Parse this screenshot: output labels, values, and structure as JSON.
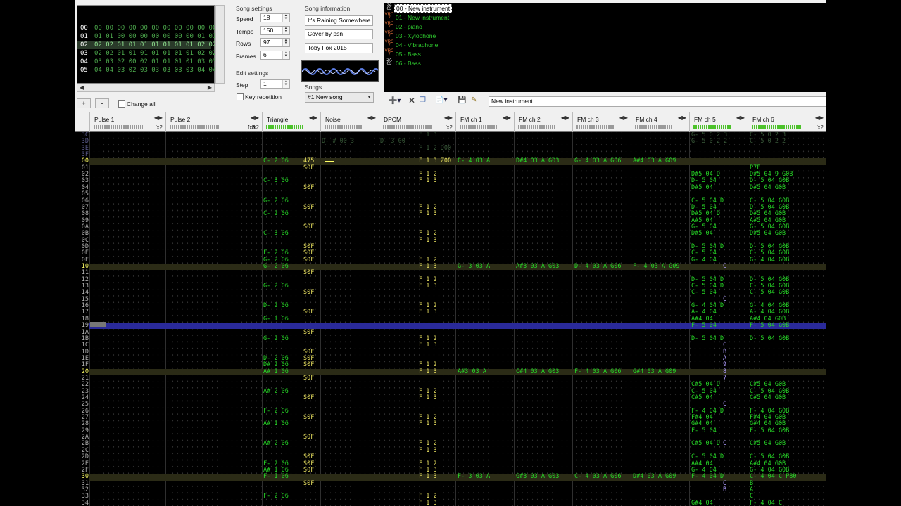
{
  "frames": {
    "rows": [
      {
        "n": "00",
        "v": "00 00 00 00 00 00 00 00 00 00 00"
      },
      {
        "n": "01",
        "v": "01 01 00 00 00 00 00 00 00 01 01"
      },
      {
        "n": "02",
        "v": "02 02 01 01 01 01 01 01 01 02 02",
        "sel": true
      },
      {
        "n": "03",
        "v": "02 02 01 01 01 01 01 01 01 02 02"
      },
      {
        "n": "04",
        "v": "03 03 02 00 02 01 01 01 01 03 03"
      },
      {
        "n": "05",
        "v": "04 04 03 02 03 03 03 03 03 04 04"
      }
    ],
    "add_label": "+",
    "remove_label": "-",
    "change_all_label": "Change all"
  },
  "song_settings": {
    "title": "Song settings",
    "speed_label": "Speed",
    "speed": "18",
    "tempo_label": "Tempo",
    "tempo": "150",
    "rows_label": "Rows",
    "rows": "97",
    "frames_label": "Frames",
    "frames": "6"
  },
  "edit_settings": {
    "title": "Edit settings",
    "step_label": "Step",
    "step": "1",
    "key_repetition_label": "Key repetition"
  },
  "song_info": {
    "title": "Song information",
    "name": "It's Raining Somewhere Else",
    "artist": "Cover by psn",
    "copyright": "Toby Fox 2015"
  },
  "songs": {
    "label": "Songs",
    "selected": "#1 New song"
  },
  "instruments": [
    {
      "icon": "2A\n03",
      "name": "00 - New instrument",
      "sel": true,
      "n": true
    },
    {
      "icon": "VRC\n7",
      "name": "01 - New instrument"
    },
    {
      "icon": "VRC\n7",
      "name": "02 - piano"
    },
    {
      "icon": "VRC\n7",
      "name": "03 - Xylophone"
    },
    {
      "icon": "VRC\n7",
      "name": "04 - Vibraphone"
    },
    {
      "icon": "VRC\n7",
      "name": "05 - Bass"
    },
    {
      "icon": "2A\n03",
      "name": "06 - Bass",
      "n": true
    }
  ],
  "instrument_name": "New instrument",
  "channels": [
    {
      "name": "Pulse 1",
      "fx": "fx2"
    },
    {
      "name": "Pulse 2",
      "fx": "fx2"
    },
    {
      "name": "",
      "fx": "fx3"
    },
    {
      "name": "Triangle",
      "fx": ""
    },
    {
      "name": "Noise",
      "fx": ""
    },
    {
      "name": "DPCM",
      "fx": "fx2"
    },
    {
      "name": "FM ch 1",
      "fx": ""
    },
    {
      "name": "FM ch 2",
      "fx": ""
    },
    {
      "name": "FM ch 3",
      "fx": ""
    },
    {
      "name": "FM ch 4",
      "fx": ""
    },
    {
      "name": "FM ch 5",
      "fx": ""
    },
    {
      "name": "FM ch 6",
      "fx": "fx2"
    }
  ],
  "row_numbers": [
    "3C",
    "3D",
    "3E",
    "3F",
    "00",
    "01",
    "02",
    "03",
    "04",
    "05",
    "06",
    "07",
    "08",
    "09",
    "0A",
    "0B",
    "0C",
    "0D",
    "0E",
    "0F",
    "10",
    "11",
    "12",
    "13",
    "14",
    "15",
    "16",
    "17",
    "18",
    "19",
    "1A",
    "1B",
    "1C",
    "1D",
    "1E",
    "1F",
    "20",
    "21",
    "22",
    "23",
    "24",
    "25",
    "26",
    "27",
    "28",
    "29",
    "2A",
    "2B",
    "2C",
    "2D",
    "2E",
    "2F",
    "30",
    "31",
    "32",
    "33",
    "34"
  ],
  "tri": [
    "",
    "",
    "",
    "",
    "C- 2 06",
    "",
    "",
    "C- 3 06",
    "",
    "",
    "G- 2 06",
    "",
    "C- 2 06",
    "",
    "",
    "C- 3 06",
    "",
    "",
    "F- 2 06",
    "G- 2 06",
    "G- 2 06",
    "",
    "",
    "G- 2 06",
    "",
    "",
    "D- 2 06",
    "",
    "G- 1 06",
    "",
    "",
    "G- 2 06",
    "",
    "",
    "D- 2 06",
    "D# 2 06",
    "A# 1 06",
    "",
    "",
    "A# 2 06",
    "",
    "",
    "F- 2 06",
    "",
    "A# 1 06",
    "",
    "",
    "A# 2 06",
    "",
    "",
    "F- 2 06",
    "A# 1 06",
    "F- 1 06",
    "",
    "",
    "F- 2 06",
    ""
  ],
  "tri_fx": [
    "",
    "",
    "",
    "",
    "475",
    "S0F",
    "",
    "",
    "S0F",
    "",
    "",
    "S0F",
    "",
    "",
    "S0F",
    "",
    "",
    "S0F",
    "S0F",
    "S0F",
    "",
    "S0F",
    "",
    "",
    "S0F",
    "",
    "",
    "S0F",
    "",
    "",
    "S0F",
    "",
    "",
    "S0F",
    "S0F",
    "S0F",
    "",
    "S0F",
    "",
    "",
    "S0F",
    "",
    "",
    "S0F",
    "",
    "",
    "S0F",
    "",
    "",
    "S0F",
    "S0F",
    "S0F",
    "",
    "S0F",
    "",
    "",
    ""
  ],
  "dpcm": [
    "F 1 3",
    "",
    "F 1 2 D00",
    "",
    "F 1 3 Z00",
    "",
    "F 1 2",
    "F 1 3",
    "",
    "",
    "",
    "F 1 2",
    "F 1 3",
    "",
    "",
    "F 1 2",
    "F 1 3",
    "",
    "",
    "F 1 2",
    "F 1 3",
    "",
    "F 1 2",
    "F 1 3",
    "",
    "",
    "F 1 2",
    "F 1 3",
    "",
    "",
    "",
    "F 1 2",
    "F 1 3",
    "",
    "",
    "F 1 2",
    "F 1 3",
    "",
    "",
    "F 1 2",
    "F 1 3",
    "",
    "",
    "F 1 2",
    "F 1 3",
    "",
    "",
    "F 1 2",
    "F 1 3",
    "",
    "F 1 2",
    "F 1 3",
    "F 1 3",
    "",
    "",
    "F 1 2",
    "F 1 3"
  ],
  "fm_rows": {
    "00": [
      "C- 4 03 A",
      "D#4 03 A G03",
      "G- 4 03 A G06",
      "A#4 03 A G09"
    ],
    "10": [
      "G- 3 03 A",
      "A#3 03 A G03",
      "D- 4 03 A G06",
      "F- 4 03 A G09"
    ],
    "20": [
      "A#3 03 A",
      "C#4 03 A G03",
      "F- 4 03 A G06",
      "G#4 03 A G09"
    ],
    "30": [
      "F- 3 03 A",
      "G#3 03 A G03",
      "C- 4 03 A G06",
      "D#4 03 A G09"
    ]
  },
  "fm5": [
    "G- 5 0 2 3",
    "G- 5 0 2 2",
    "",
    "",
    "",
    "",
    "D#5 04 D",
    "D- 5 04",
    "D#5 04",
    "",
    "C- 5 04 D",
    "D- 5 04",
    "D#5 04 D",
    "A#5 04",
    "G- 5 04",
    "D#5 04",
    "",
    "D- 5 04 D",
    "C- 5 04",
    "G- 4 04",
    "",
    "",
    "D- 5 04 D",
    "C- 5 04 D",
    "C- 5 04",
    "",
    "G- 4 04 D",
    "A- 4 04",
    "A#4 04",
    "F- 5 04",
    "",
    "D- 5 04 D",
    "",
    "",
    "",
    "",
    "",
    "",
    "C#5 04 D",
    "C- 5 04",
    "C#5 04",
    "",
    "F- 4 04 D",
    "F#4 04",
    "G#4 04",
    "F- 5 04",
    "",
    "C#5 04 D",
    "",
    "C- 5 04 D",
    "A#4 04",
    "G- 4 04",
    "F- 4 04 D",
    "",
    "",
    "",
    "G#4 04"
  ],
  "fm6": [
    "C- 5 0 2 3",
    "C- 5 0 2 2",
    "",
    "",
    "",
    "P7F",
    "D#5 04 9 G0B",
    "D- 5 04 G0B",
    "D#5 04 G0B",
    "",
    "C- 5 04 G0B",
    "D- 5 04 G0B",
    "D#5 04 G0B",
    "A#5 04 G0B",
    "G- 5 04 G0B",
    "D#5 04 G0B",
    "",
    "D- 5 04 G0B",
    "C- 5 04 G0B",
    "G- 4 04 G0B",
    "",
    "",
    "D- 5 04 G0B",
    "C- 5 04 G0B",
    "C- 5 04 G0B",
    "",
    "G- 4 04 G0B",
    "A- 4 04 G0B",
    "A#4 04 G0B",
    "F- 5 04 G0B",
    "",
    "D- 5 04 G0B",
    "",
    "",
    "",
    "",
    "",
    "",
    "C#5 04 G0B",
    "C- 5 04 G0B",
    "C#5 04 G0B",
    "",
    "F- 4 04 G0B",
    "F#4 04 G0B",
    "G#4 04 G0B",
    "F- 5 04 G0B",
    "",
    "C#5 04 G0B",
    "",
    "C- 5 04 G0B",
    "A#4 04 G0B",
    "G- 4 04 G0B",
    "C- 4 04 C P80",
    "B",
    "A",
    "C",
    "F- 4 04 C"
  ],
  "fm5_extra": [
    "",
    "",
    "",
    "",
    "",
    "",
    "",
    "",
    "",
    "",
    "",
    "",
    "",
    "",
    "",
    "",
    "",
    "",
    "",
    "",
    "C",
    "",
    "",
    "",
    "",
    "C",
    "",
    "",
    "",
    "",
    "",
    "",
    "C",
    "B",
    "A",
    "9",
    "8",
    "7",
    "",
    "",
    "",
    "C",
    "",
    "",
    "",
    "",
    "",
    "C",
    "",
    "",
    "",
    "",
    "",
    "C",
    "B",
    "",
    ""
  ],
  "noise_ghost": "D- # 00 3",
  "dpcm_ghost": "D- 3 00"
}
